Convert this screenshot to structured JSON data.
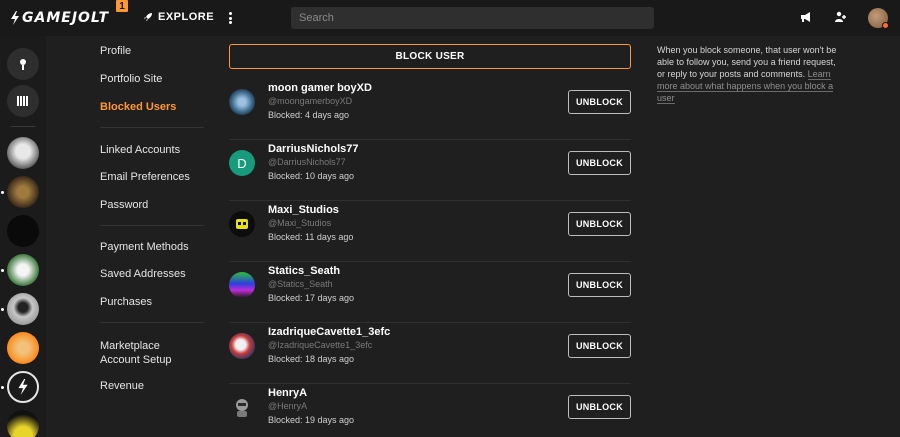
{
  "topbar": {
    "logo_text": "GAMEJOLT",
    "notification_count": "1",
    "explore_label": "EXPLORE",
    "search_placeholder": "Search",
    "icons": [
      "megaphone-icon",
      "friends-icon",
      "user-avatar"
    ]
  },
  "nav": {
    "items": [
      {
        "label": "Profile",
        "active": false
      },
      {
        "label": "Portfolio Site",
        "active": false
      },
      {
        "label": "Blocked Users",
        "active": true
      },
      {
        "label": "Linked Accounts",
        "active": false
      },
      {
        "label": "Email Preferences",
        "active": false
      },
      {
        "label": "Password",
        "active": false
      },
      {
        "label": "Payment Methods",
        "active": false
      },
      {
        "label": "Saved Addresses",
        "active": false
      },
      {
        "label": "Purchases",
        "active": false
      },
      {
        "label": "Marketplace Account Setup",
        "active": false
      },
      {
        "label": "Revenue",
        "active": false
      }
    ]
  },
  "main": {
    "block_button_label": "BLOCK USER",
    "unblock_label": "UNBLOCK",
    "users": [
      {
        "name": "moon gamer boyXD",
        "handle": "@moongamerboyXD",
        "blocked": "Blocked: 4 days ago"
      },
      {
        "name": "DarriusNichols77",
        "handle": "@DarriusNichols77",
        "blocked": "Blocked: 10 days ago",
        "initial": "D"
      },
      {
        "name": "Maxi_Studios",
        "handle": "@Maxi_Studios",
        "blocked": "Blocked: 11 days ago"
      },
      {
        "name": "Statics_Seath",
        "handle": "@Statics_Seath",
        "blocked": "Blocked: 17 days ago"
      },
      {
        "name": "IzadriqueCavette1_3efc",
        "handle": "@IzadriqueCavette1_3efc",
        "blocked": "Blocked: 18 days ago"
      },
      {
        "name": "HenryA",
        "handle": "@HenryA",
        "blocked": "Blocked: 19 days ago"
      }
    ]
  },
  "info": {
    "text": "When you block someone, that user won't be able to follow you, send you a friend request, or reply to your posts and comments. ",
    "link": "Learn more about what happens when you block a user"
  },
  "colors": {
    "accent": "#ff9934",
    "background": "#1f1f1f",
    "topbar": "#191919"
  }
}
